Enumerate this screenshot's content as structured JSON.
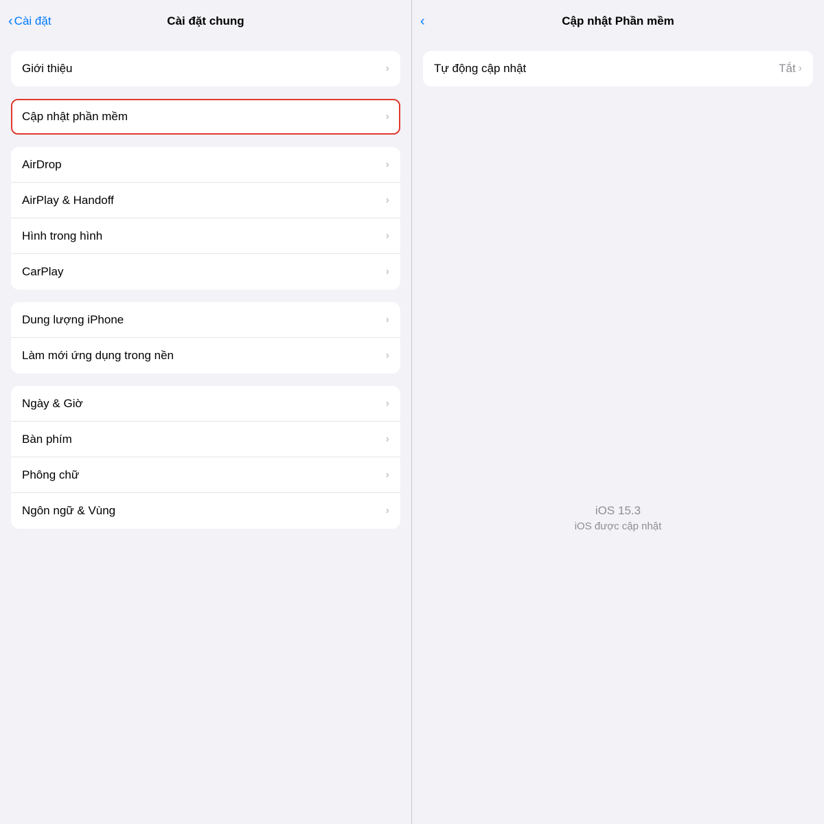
{
  "left_panel": {
    "nav_back_icon": "‹",
    "nav_back_label": "Cài đặt",
    "nav_title": "Cài đặt chung",
    "sections": [
      {
        "id": "section1",
        "items": [
          {
            "id": "gioi-thieu",
            "label": "Giới thiệu",
            "highlighted": false
          }
        ]
      },
      {
        "id": "section2",
        "items": [
          {
            "id": "cap-nhat-phan-mem",
            "label": "Cập nhật phần mềm",
            "highlighted": true
          }
        ]
      },
      {
        "id": "section3",
        "items": [
          {
            "id": "airdrop",
            "label": "AirDrop",
            "highlighted": false
          },
          {
            "id": "airplay-handoff",
            "label": "AirPlay & Handoff",
            "highlighted": false
          },
          {
            "id": "hinh-trong-hinh",
            "label": "Hình trong hình",
            "highlighted": false
          },
          {
            "id": "carplay",
            "label": "CarPlay",
            "highlighted": false
          }
        ]
      },
      {
        "id": "section4",
        "items": [
          {
            "id": "dung-luong-iphone",
            "label": "Dung lượng iPhone",
            "highlighted": false
          },
          {
            "id": "lam-moi-ung-dung",
            "label": "Làm mới ứng dụng trong nền",
            "highlighted": false
          }
        ]
      },
      {
        "id": "section5",
        "items": [
          {
            "id": "ngay-gio",
            "label": "Ngày & Giờ",
            "highlighted": false
          },
          {
            "id": "ban-phim",
            "label": "Bàn phím",
            "highlighted": false
          },
          {
            "id": "phong-chu",
            "label": "Phông chữ",
            "highlighted": false
          },
          {
            "id": "ngon-ngu-vung",
            "label": "Ngôn ngữ & Vùng",
            "highlighted": false
          }
        ]
      }
    ]
  },
  "right_panel": {
    "nav_back_icon": "‹",
    "nav_title": "Cập nhật Phần mềm",
    "auto_update_label": "Tự động cập nhật",
    "auto_update_value": "Tắt",
    "ios_version": "iOS 15.3",
    "ios_status": "iOS được cập nhật"
  },
  "chevron": "›"
}
